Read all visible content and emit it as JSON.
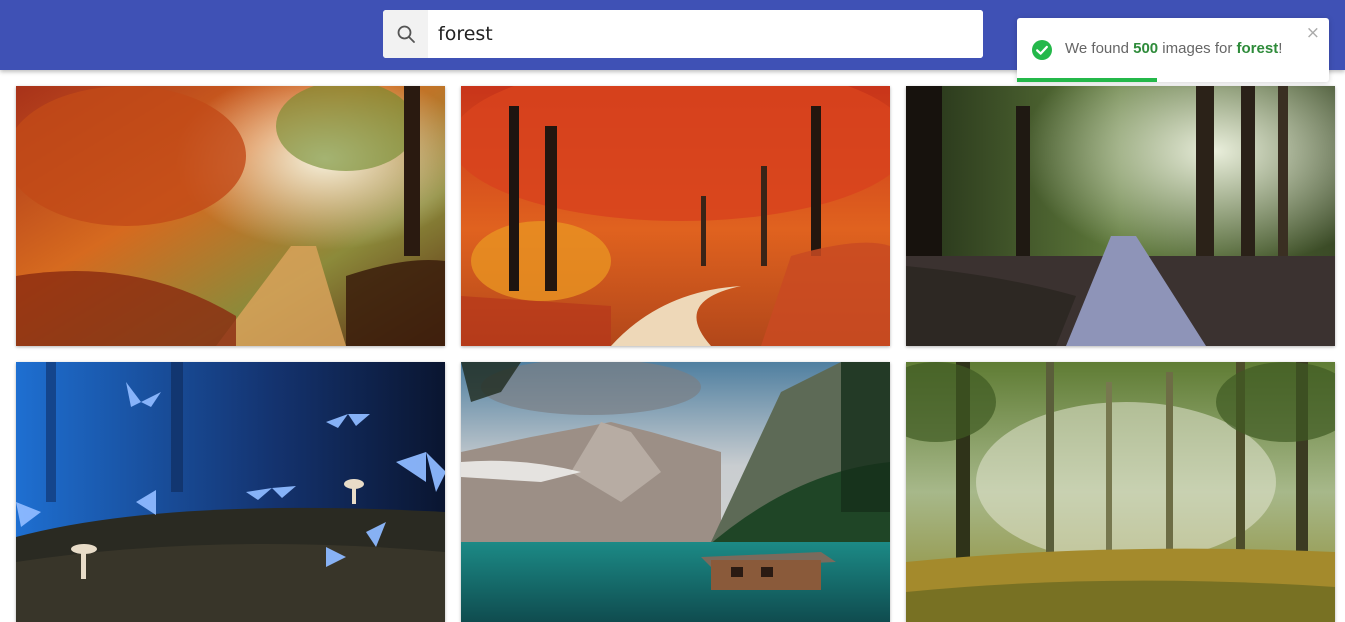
{
  "search": {
    "value": "forest",
    "icon": "search-icon"
  },
  "toast": {
    "prefix": "We found ",
    "count": "500",
    "middle": " images for ",
    "query": "forest",
    "suffix": "!",
    "close": "×",
    "progress": 0.45,
    "status_color": "#24b84a"
  },
  "colors": {
    "header": "#3f51b5",
    "success": "#24b84a"
  },
  "gallery": {
    "images": [
      {
        "subject": "autumn forest path with orange foliage"
      },
      {
        "subject": "red autumn trees over winding path"
      },
      {
        "subject": "sunlit green forest road"
      },
      {
        "subject": "blue butterflies and mushrooms at night"
      },
      {
        "subject": "mountain lake with boathouse"
      },
      {
        "subject": "misty green birch forest"
      }
    ]
  }
}
